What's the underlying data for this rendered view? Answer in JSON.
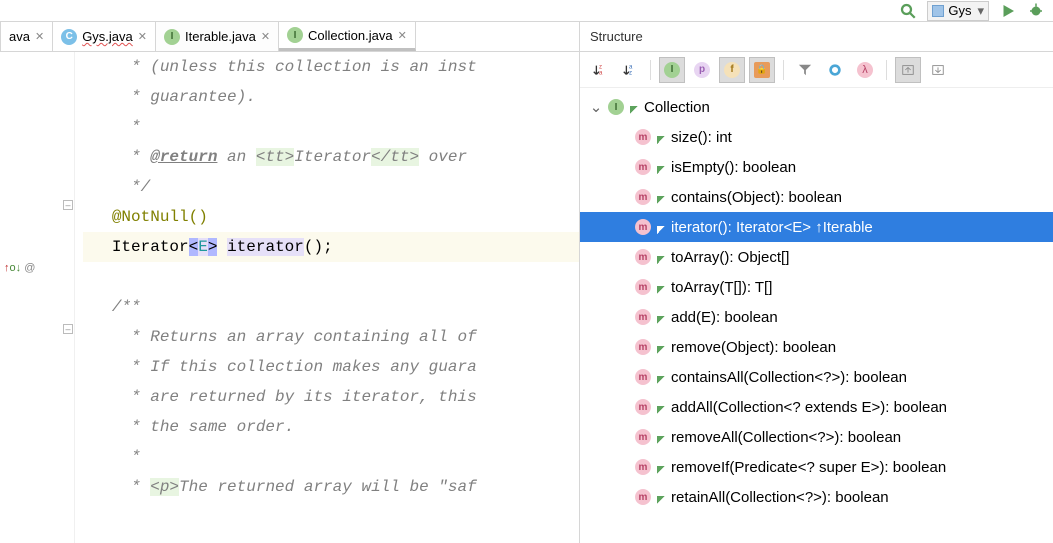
{
  "top_toolbar": {
    "combo_value": "Gys"
  },
  "tabs": [
    {
      "label": "ava",
      "icon": null
    },
    {
      "label": "Gys.java",
      "icon": "c",
      "wavy": true
    },
    {
      "label": "Iterable.java",
      "icon": "i"
    },
    {
      "label": "Collection.java",
      "icon": "i",
      "active": true
    }
  ],
  "structure_title": "Structure",
  "root_node": "Collection",
  "methods": [
    {
      "sig": "size(): int"
    },
    {
      "sig": "isEmpty(): boolean"
    },
    {
      "sig": "contains(Object): boolean"
    },
    {
      "sig": "iterator(): Iterator<E> ↑Iterable",
      "selected": true
    },
    {
      "sig": "toArray(): Object[]"
    },
    {
      "sig": "toArray(T[]): T[]"
    },
    {
      "sig": "add(E): boolean"
    },
    {
      "sig": "remove(Object): boolean"
    },
    {
      "sig": "containsAll(Collection<?>): boolean"
    },
    {
      "sig": "addAll(Collection<? extends E>): boolean"
    },
    {
      "sig": "removeAll(Collection<?>): boolean"
    },
    {
      "sig": "removeIf(Predicate<? super E>): boolean"
    },
    {
      "sig": "retainAll(Collection<?>): boolean"
    }
  ],
  "code": {
    "l1_a": " * (unless this collection is an inst",
    "l2": " * guarantee).",
    "l3": " *",
    "l4_a": " * ",
    "l4_tag": "@return",
    "l4_b": " an ",
    "l4_tt1": "<tt>",
    "l4_mid": "Iterator",
    "l4_tt2": "</tt>",
    "l4_c": " over ",
    "l5": " */",
    "l6": "@NotNull()",
    "l7_a": "Iterator",
    "l7_lt": "<",
    "l7_e": "E",
    "l7_gt": ">",
    "l7_b": " ",
    "l7_it": "iterator",
    "l7_c": "();",
    "l9": "/**",
    "l10": " * Returns an array containing all of",
    "l11": " * If this collection makes any guara",
    "l12": " * are returned by its iterator, this",
    "l13": " * the same order.",
    "l14": " *",
    "l15a": " * ",
    "l15p": "<p>",
    "l15b": "The returned array will be \"saf"
  },
  "gutter_override_glyph": "↑O↓ @"
}
